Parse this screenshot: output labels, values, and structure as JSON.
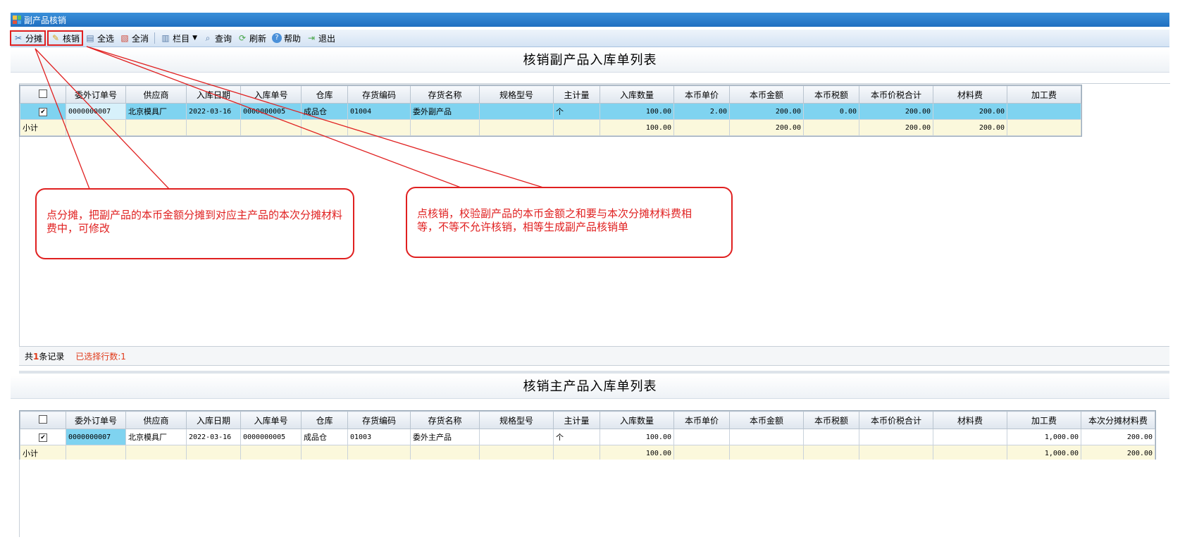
{
  "window": {
    "title": "副产品核销"
  },
  "toolbar": {
    "apportion": "分摊",
    "verify": "核销",
    "select_all": "全选",
    "deselect_all": "全消",
    "columns": "栏目",
    "query": "查询",
    "refresh": "刷新",
    "help": "帮助",
    "exit": "退出"
  },
  "by_product": {
    "title": "核销副产品入库单列表",
    "headers": [
      "",
      "委外订单号",
      "供应商",
      "入库日期",
      "入库单号",
      "仓库",
      "存货编码",
      "存货名称",
      "规格型号",
      "主计量",
      "入库数量",
      "本币单价",
      "本币金额",
      "本币税额",
      "本币价税合计",
      "材料费",
      "加工费"
    ],
    "rows": [
      [
        "✔",
        "0000000007",
        "北京模具厂",
        "2022-03-16",
        "0000000005",
        "成品仓",
        "01004",
        "委外副产品",
        "",
        "个",
        "100.00",
        "2.00",
        "200.00",
        "0.00",
        "200.00",
        "200.00",
        ""
      ]
    ],
    "subtotal": [
      "小计",
      "",
      "",
      "",
      "",
      "",
      "",
      "",
      "",
      "",
      "100.00",
      "",
      "200.00",
      "",
      "200.00",
      "200.00",
      ""
    ],
    "footer": {
      "prefix": "共",
      "count": "1",
      "suffix": "条记录",
      "selected": "已选择行数:1"
    }
  },
  "main_product": {
    "title": "核销主产品入库单列表",
    "headers": [
      "",
      "委外订单号",
      "供应商",
      "入库日期",
      "入库单号",
      "仓库",
      "存货编码",
      "存货名称",
      "规格型号",
      "主计量",
      "入库数量",
      "本币单价",
      "本币金额",
      "本币税额",
      "本币价税合计",
      "材料费",
      "加工费",
      "本次分摊材料费"
    ],
    "rows": [
      [
        "✔",
        "0000000007",
        "北京模具厂",
        "2022-03-16",
        "0000000005",
        "成品仓",
        "01003",
        "委外主产品",
        "",
        "个",
        "100.00",
        "",
        "",
        "",
        "",
        "",
        "1,000.00",
        "200.00"
      ]
    ],
    "subtotal": [
      "小计",
      "",
      "",
      "",
      "",
      "",
      "",
      "",
      "",
      "",
      "100.00",
      "",
      "",
      "",
      "",
      "",
      "1,000.00",
      "200.00"
    ]
  },
  "annotations": {
    "apportion_note": "点分摊，把副产品的本币金额分摊到对应主产品的本次分摊材料费中，可修改",
    "verify_note": "点核销，校验副产品的本币金额之和要与本次分摊材料费相等，不等不允许核销，相等生成副产品核销单"
  },
  "colors": {
    "annotation": "#e02020",
    "selected_row": "#7fd3f0",
    "subtotal_row": "#fbf8dc",
    "titlebar": "#2a7fd0"
  }
}
